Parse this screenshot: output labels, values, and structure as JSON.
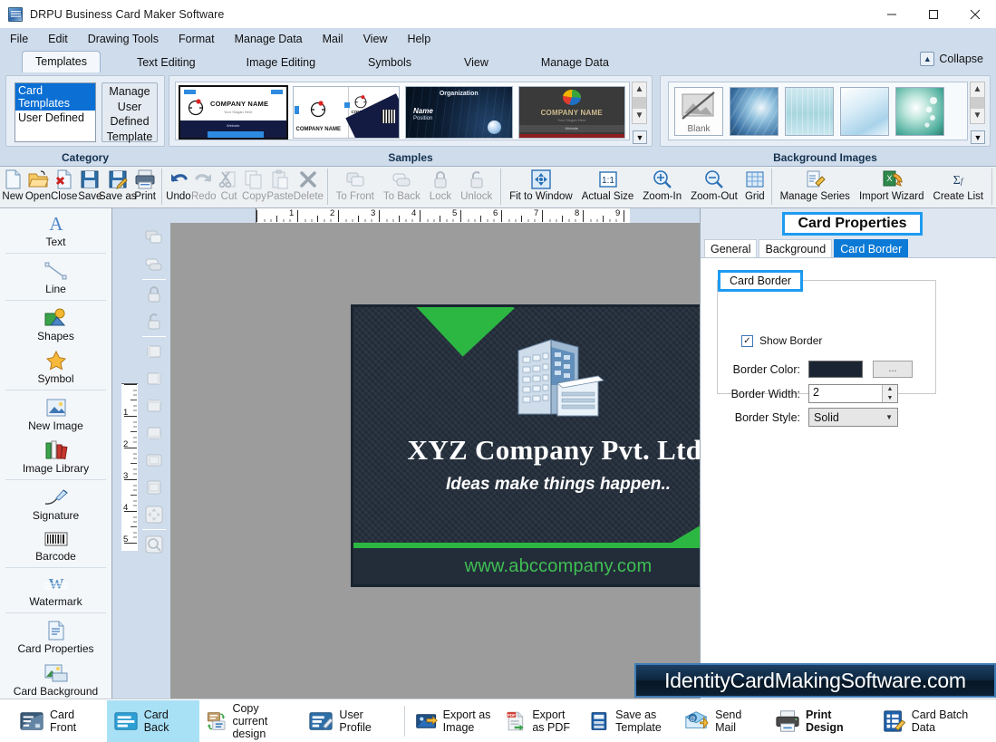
{
  "window": {
    "title": "DRPU Business Card Maker Software",
    "icon": "app-icon",
    "minimize": "minimize",
    "maximize": "maximize",
    "close": "close"
  },
  "menubar": {
    "items": [
      "File",
      "Edit",
      "Drawing Tools",
      "Format",
      "Manage Data",
      "Mail",
      "View",
      "Help"
    ]
  },
  "ribbon_tabs": {
    "items": [
      "Templates",
      "Text Editing",
      "Image Editing",
      "Symbols",
      "View",
      "Manage Data"
    ],
    "active": "Templates",
    "collapse_label": "Collapse"
  },
  "ribbon": {
    "category": {
      "group_label": "Category",
      "list": [
        "Card Templates",
        "User Defined"
      ],
      "selected": "Card Templates",
      "manage_button": "Manage User Defined Template"
    },
    "samples": {
      "group_label": "Samples",
      "items": [
        {
          "name": "sample-1",
          "title": "COMPANY NAME",
          "slogan": "Your Slogan Here",
          "footer": "Website",
          "selected": true
        },
        {
          "name": "sample-2",
          "title": "COMPANY NAME",
          "slogan": "Your Slogan Here",
          "selected": false
        },
        {
          "name": "sample-3",
          "title": "Organization",
          "name_line": "Name",
          "position_line": "Position",
          "selected": false
        },
        {
          "name": "sample-4",
          "title": "COMPANY NAME",
          "slogan": "Your Slogan Here",
          "footer": "Website",
          "selected": false
        }
      ]
    },
    "background_images": {
      "group_label": "Background Images",
      "items": [
        "Blank",
        "bg-blue-swirl",
        "bg-teal-ship",
        "bg-light-blue",
        "bg-green-pearl"
      ]
    }
  },
  "toolbar": {
    "items": [
      {
        "label": "New",
        "icon": "new-document-icon",
        "enabled": true
      },
      {
        "label": "Open",
        "icon": "open-folder-icon",
        "enabled": true
      },
      {
        "label": "Close",
        "icon": "close-document-icon",
        "enabled": true
      },
      {
        "label": "Save",
        "icon": "save-icon",
        "enabled": true
      },
      {
        "label": "Save as",
        "icon": "save-as-icon",
        "enabled": true
      },
      {
        "label": "Print",
        "icon": "printer-icon",
        "enabled": true
      },
      {
        "label": "Undo",
        "icon": "undo-icon",
        "enabled": true
      },
      {
        "label": "Redo",
        "icon": "redo-icon",
        "enabled": false
      },
      {
        "label": "Cut",
        "icon": "scissors-icon",
        "enabled": false
      },
      {
        "label": "Copy",
        "icon": "copy-icon",
        "enabled": false
      },
      {
        "label": "Paste",
        "icon": "paste-icon",
        "enabled": false
      },
      {
        "label": "Delete",
        "icon": "delete-x-icon",
        "enabled": false
      },
      {
        "label": "To Front",
        "icon": "to-front-icon",
        "enabled": false
      },
      {
        "label": "To Back",
        "icon": "to-back-icon",
        "enabled": false
      },
      {
        "label": "Lock",
        "icon": "lock-icon",
        "enabled": false
      },
      {
        "label": "Unlock",
        "icon": "unlock-icon",
        "enabled": false
      },
      {
        "label": "Fit to Window",
        "icon": "fit-to-window-icon",
        "enabled": true
      },
      {
        "label": "Actual Size",
        "icon": "actual-size-icon",
        "enabled": true
      },
      {
        "label": "Zoom-In",
        "icon": "zoom-in-icon",
        "enabled": true
      },
      {
        "label": "Zoom-Out",
        "icon": "zoom-out-icon",
        "enabled": true
      },
      {
        "label": "Grid",
        "icon": "grid-icon",
        "enabled": true
      },
      {
        "label": "Manage Series",
        "icon": "manage-series-icon",
        "enabled": true
      },
      {
        "label": "Import Wizard",
        "icon": "import-wizard-icon",
        "enabled": true
      },
      {
        "label": "Create List",
        "icon": "create-list-icon",
        "enabled": true
      }
    ]
  },
  "left_palette": {
    "items": [
      {
        "label": "Text",
        "icon": "text-a-icon"
      },
      {
        "label": "Line",
        "icon": "line-icon"
      },
      {
        "label": "Shapes",
        "icon": "shapes-icon"
      },
      {
        "label": "Symbol",
        "icon": "symbol-star-icon"
      },
      {
        "label": "New Image",
        "icon": "new-image-icon"
      },
      {
        "label": "Image Library",
        "icon": "image-library-icon"
      },
      {
        "label": "Signature",
        "icon": "signature-pen-icon"
      },
      {
        "label": "Barcode",
        "icon": "barcode-icon"
      },
      {
        "label": "Watermark",
        "icon": "watermark-w-icon"
      },
      {
        "label": "Card Properties",
        "icon": "card-properties-icon"
      },
      {
        "label": "Card Background",
        "icon": "card-background-icon"
      }
    ]
  },
  "canvas": {
    "ruler_h_ticks": [
      "1",
      "2",
      "3",
      "4",
      "5",
      "6",
      "7",
      "8",
      "9"
    ],
    "ruler_v_ticks": [
      "1",
      "2",
      "3",
      "4",
      "5"
    ],
    "vertical_tools": [
      "to-front-icon",
      "to-back-icon",
      "lock-icon",
      "unlock-icon",
      "align-left-icon",
      "align-right-icon",
      "align-top-icon",
      "align-bottom-icon",
      "align-center-h-icon",
      "align-center-v-icon",
      "fit-icon",
      "zoom-icon"
    ],
    "card": {
      "company_name": "XYZ Company Pvt. Ltd.",
      "slogan": "Ideas make things happen..",
      "website": "www.abccompany.com",
      "logo": "office-building-icon",
      "background_color": "#242f3c",
      "accent_color": "#2cb742",
      "website_color": "#3fbf52"
    }
  },
  "card_properties": {
    "panel_title": "Card Properties",
    "tabs": [
      "General",
      "Background",
      "Card Border"
    ],
    "active_tab": "Card Border",
    "group_caption": "Card Border",
    "show_border": {
      "label": "Show Border",
      "checked": true
    },
    "fields": [
      {
        "label": "Border Color:",
        "type": "color",
        "value": "#1b2432",
        "picker_label": "..."
      },
      {
        "label": "Border Width:",
        "type": "spinner",
        "value": "2"
      },
      {
        "label": "Border Style:",
        "type": "select",
        "value": "Solid"
      }
    ]
  },
  "watermark": {
    "text": "IdentityCardMakingSoftware.com"
  },
  "bottom_bar": {
    "items": [
      {
        "label": "Card Front",
        "icon": "card-front-icon",
        "selected": false,
        "bold": false
      },
      {
        "label": "Card Back",
        "icon": "card-back-icon",
        "selected": true,
        "bold": false
      },
      {
        "label": "Copy current design",
        "icon": "copy-design-icon",
        "selected": false,
        "bold": false
      },
      {
        "label": "User Profile",
        "icon": "user-profile-icon",
        "selected": false,
        "bold": false
      },
      {
        "label": "Export as Image",
        "icon": "export-image-icon",
        "selected": false,
        "bold": false
      },
      {
        "label": "Export as PDF",
        "icon": "export-pdf-icon",
        "selected": false,
        "bold": false
      },
      {
        "label": "Save as Template",
        "icon": "save-template-icon",
        "selected": false,
        "bold": false
      },
      {
        "label": "Send Mail",
        "icon": "send-mail-icon",
        "selected": false,
        "bold": false
      },
      {
        "label": "Print Design",
        "icon": "print-design-icon",
        "selected": false,
        "bold": true
      },
      {
        "label": "Card Batch Data",
        "icon": "card-batch-data-icon",
        "selected": false,
        "bold": false
      }
    ]
  }
}
